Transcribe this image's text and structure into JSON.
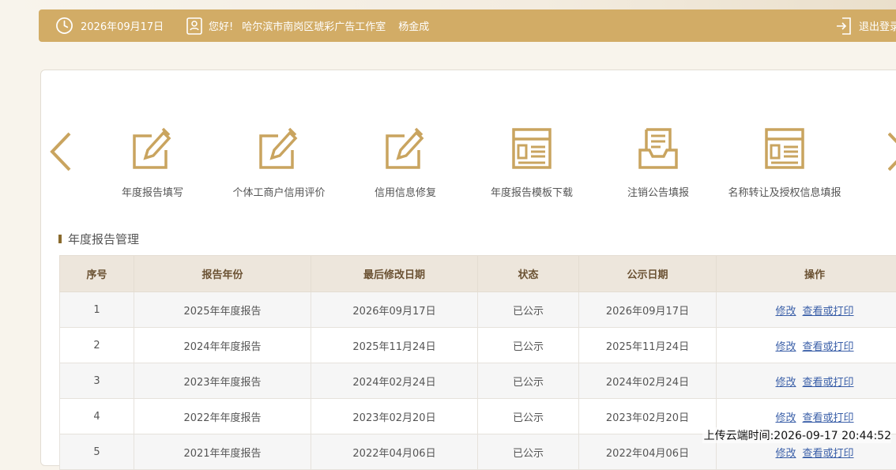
{
  "header": {
    "date": "2026年09月17日",
    "greeting": "您好!",
    "company": "哈尔滨市南岗区琥彩广告工作室",
    "user": "杨金成",
    "logout": "退出登录"
  },
  "quick_links": [
    {
      "label": "年度报告填写",
      "icon": "edit-icon"
    },
    {
      "label": "个体工商户信用评价",
      "icon": "edit-icon"
    },
    {
      "label": "信用信息修复",
      "icon": "edit-icon"
    },
    {
      "label": "年度报告模板下载",
      "icon": "template-icon"
    },
    {
      "label": "注销公告填报",
      "icon": "inbox-icon"
    },
    {
      "label": "名称转让及授权信息填报",
      "icon": "template-icon"
    }
  ],
  "section": {
    "title": "年度报告管理"
  },
  "table": {
    "headers": [
      "序号",
      "报告年份",
      "最后修改日期",
      "状态",
      "公示日期",
      "操作"
    ],
    "rows": [
      {
        "no": "1",
        "year": "2025年年度报告",
        "modified": "2026年09月17日",
        "status": "已公示",
        "published": "2026年09月17日"
      },
      {
        "no": "2",
        "year": "2024年年度报告",
        "modified": "2025年11月24日",
        "status": "已公示",
        "published": "2025年11月24日"
      },
      {
        "no": "3",
        "year": "2023年年度报告",
        "modified": "2024年02月24日",
        "status": "已公示",
        "published": "2024年02月24日"
      },
      {
        "no": "4",
        "year": "2022年年度报告",
        "modified": "2023年02月20日",
        "status": "已公示",
        "published": "2023年02月20日"
      },
      {
        "no": "5",
        "year": "2021年年度报告",
        "modified": "2022年04月06日",
        "status": "已公示",
        "published": "2022年04月06日"
      }
    ],
    "edit_label": "修改",
    "view_label": "查看或打印"
  },
  "upload_time": "上传云端时间:2026-09-17 20:44:52",
  "colors": {
    "accent": "#d2ac66",
    "header_bg": "#ede6dc",
    "link": "#3a5fa8"
  }
}
